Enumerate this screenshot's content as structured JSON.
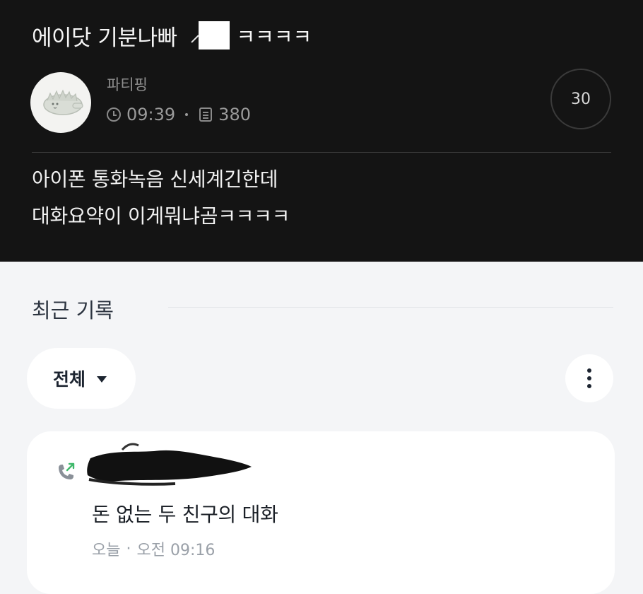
{
  "post": {
    "title": "에이닷 기분나빠",
    "title_suffix": "ㅋㅋㅋㅋ",
    "author": "파티핑",
    "time": "09:39",
    "views": "380",
    "comment_count": "30",
    "body_lines": [
      "아이폰 통화녹음 신세계긴한데",
      "대화요약이 이게뭐냐곰ㅋㅋㅋㅋ"
    ],
    "avatar_icon": "dinosaur-avatar-icon"
  },
  "recent": {
    "title": "최근 기록",
    "filter_label": "전체",
    "more_icon": "vertical-dots-icon",
    "accent_color": "#3fb96b",
    "card": {
      "call_icon": "outgoing-call-icon",
      "call_title": "돈 없는 두 친구의 대화",
      "day": "오늘",
      "separator": "·",
      "time": "오전 09:16"
    }
  }
}
